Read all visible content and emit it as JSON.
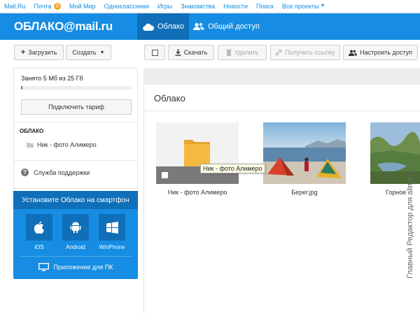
{
  "portal": {
    "links": [
      "Mail.Ru",
      "Почта",
      "Мой Мир",
      "Одноклассники",
      "Игры",
      "Знакомства",
      "Новости",
      "Поиск",
      "Все проекты"
    ],
    "mail_badge": "3"
  },
  "header": {
    "logo_left": "ОБЛАКО",
    "logo_at": "@",
    "logo_right": "mail.ru",
    "nav_cloud": "Облако",
    "nav_share": "Общий доступ"
  },
  "toolbar": {
    "upload": "Загрузить",
    "create": "Создать",
    "download": "Скачать",
    "delete": "Удалить",
    "get_link": "Получить ссылку",
    "configure_access": "Настроить доступ"
  },
  "sidebar": {
    "quota_text": "Занято 5 Мб из 25 Гб",
    "quota_fraction": 0.0002,
    "plan_button": "Подключить тариф",
    "section_title": "ОБЛАКО",
    "folder": "Ник - фото Алимеро",
    "support": "Служба поддержки"
  },
  "promo": {
    "title": "Установите Облако на смартфон",
    "ios": "iOS",
    "android": "Android",
    "winphone": "WinPhone",
    "pc": "Приложение для ПК"
  },
  "main": {
    "breadcrumb": "Облако",
    "items": [
      {
        "name": "Ник - фото Алимеро"
      },
      {
        "name": "Берег.jpg"
      },
      {
        "name": "Горное "
      }
    ],
    "tooltip": "Ник - фото Алимеро"
  },
  "watermark": "Главный Редактор для alimero.ru",
  "colors": {
    "accent": "#168de2",
    "accent_dark": "#0f6fb8",
    "folder": "#f5b940"
  }
}
